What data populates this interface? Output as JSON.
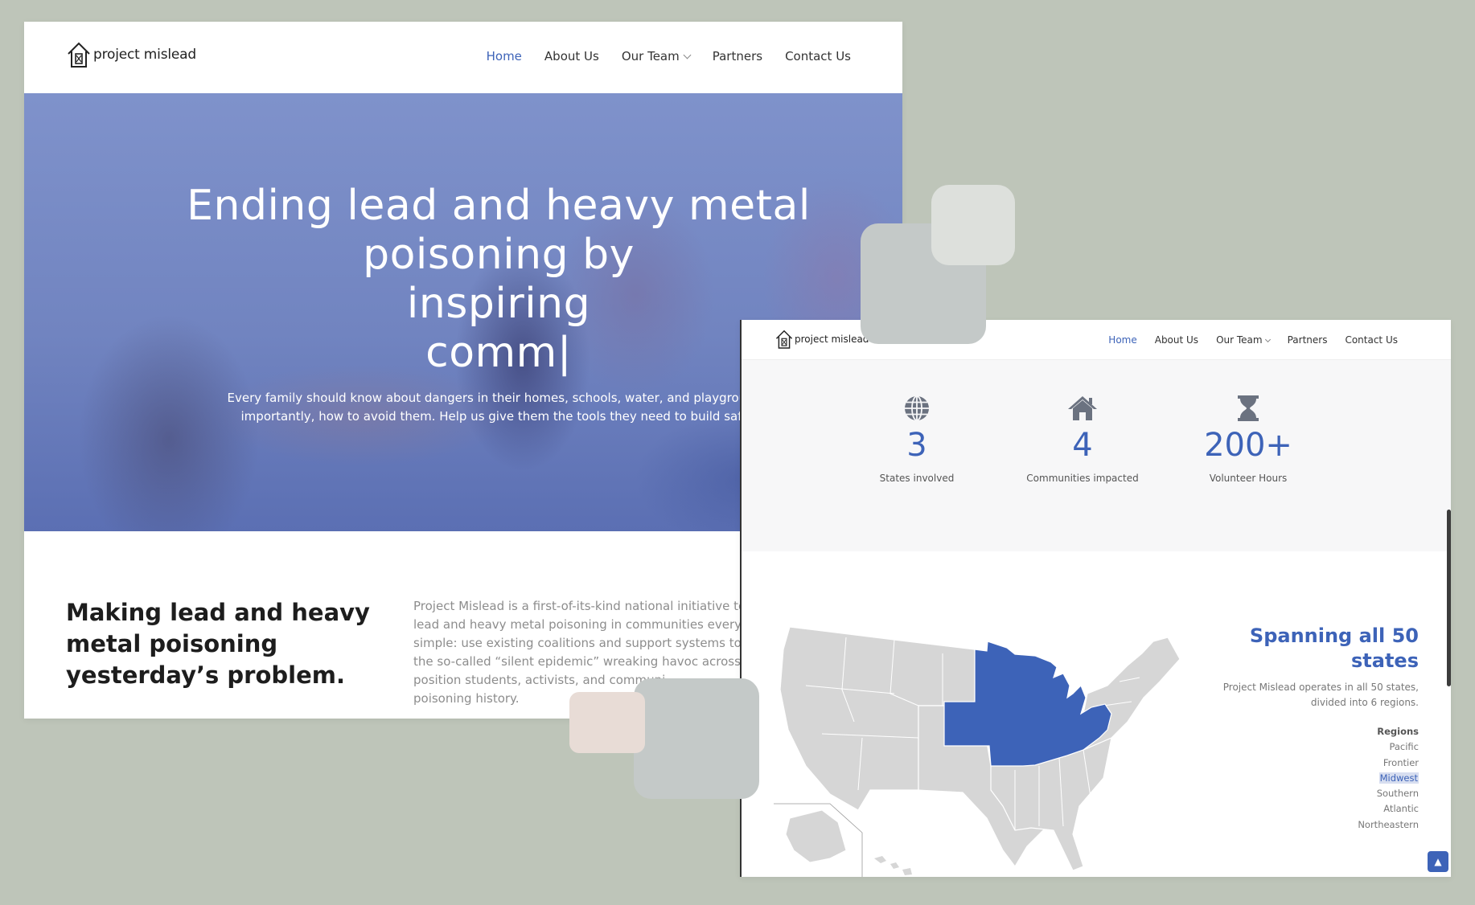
{
  "window1": {
    "logo_text": "project mislead",
    "nav": {
      "home": "Home",
      "about": "About Us",
      "team": "Our Team",
      "partners": "Partners",
      "contact": "Contact Us"
    },
    "hero": {
      "title_lines": [
        "Ending lead and heavy metal",
        "poisoning by",
        "inspiring",
        "comm|"
      ],
      "subtitle_lines": [
        "Every family should know about dangers in their homes, schools, water, and playgrounds - and m",
        "importantly, how to avoid them. Help us give them the tools they need to build safer futures."
      ]
    },
    "about": {
      "heading": "Making lead and heavy metal poisoning yesterday’s problem.",
      "paragraph_lines": [
        "Project Mislead is a first-of-its-kind national initiative to",
        "lead and heavy metal poisoning in communities everyw",
        "simple: use existing coalitions and support systems to sp",
        "the so-called “silent epidemic” wreaking havoc across h",
        "position students, activists, and communi",
        "poisoning history."
      ]
    }
  },
  "window2": {
    "logo_text": "project mislead",
    "nav": {
      "home": "Home",
      "about": "About Us",
      "team": "Our Team",
      "partners": "Partners",
      "contact": "Contact Us"
    },
    "stats": [
      {
        "icon": "globe-icon",
        "value": "3",
        "label": "States involved"
      },
      {
        "icon": "house-icon",
        "value": "4",
        "label": "Communities impacted"
      },
      {
        "icon": "hourglass-icon",
        "value": "200+",
        "label": "Volunteer Hours"
      }
    ],
    "map": {
      "heading": "Spanning all 50 states",
      "description_lines": [
        "Project Mislead operates in all 50 states,",
        "divided into 6 regions."
      ],
      "regions_heading": "Regions",
      "regions": [
        "Pacific",
        "Frontier",
        "Midwest",
        "Southern",
        "Atlantic",
        "Northeastern"
      ],
      "highlighted_region": "Midwest"
    }
  },
  "colors": {
    "accent": "#3d63b8",
    "background": "#bec5b9",
    "highlight_region": "#3d63b8",
    "map_gray": "#d6d6d6"
  }
}
